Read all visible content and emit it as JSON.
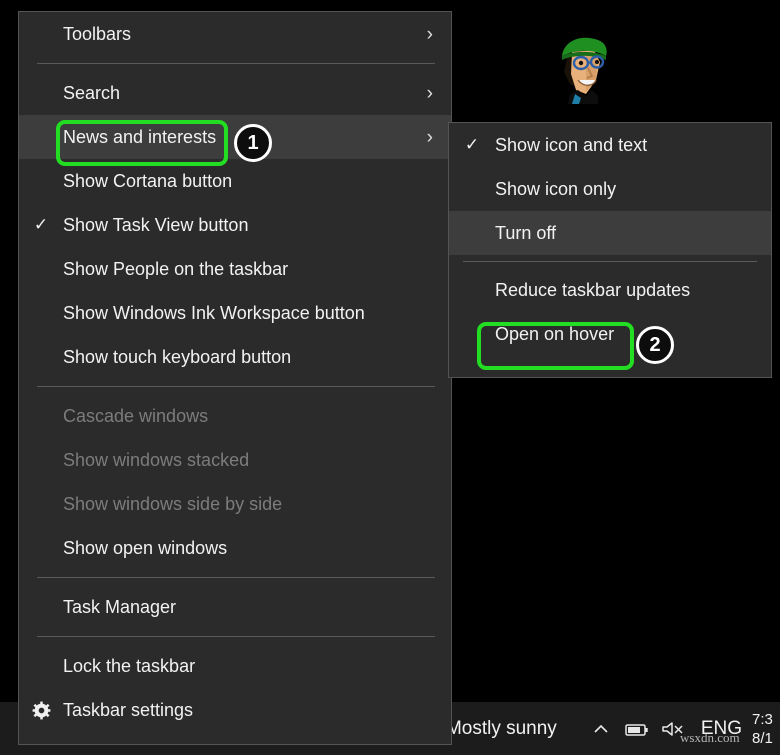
{
  "desktop": {
    "background_color": "#000000",
    "avatar_alt": "cartoon-character-green-cap"
  },
  "main_menu": {
    "name": "taskbar-context-menu",
    "items": [
      {
        "label": "Toolbars",
        "checked": false,
        "submenu": true,
        "disabled": false,
        "highlighted": false
      },
      {
        "separator": true
      },
      {
        "label": "Search",
        "checked": false,
        "submenu": true,
        "disabled": false,
        "highlighted": false
      },
      {
        "label": "News and interests",
        "checked": false,
        "submenu": true,
        "disabled": false,
        "highlighted": true
      },
      {
        "label": "Show Cortana button",
        "checked": false,
        "submenu": false,
        "disabled": false,
        "highlighted": false
      },
      {
        "label": "Show Task View button",
        "checked": true,
        "submenu": false,
        "disabled": false,
        "highlighted": false
      },
      {
        "label": "Show People on the taskbar",
        "checked": false,
        "submenu": false,
        "disabled": false,
        "highlighted": false
      },
      {
        "label": "Show Windows Ink Workspace button",
        "checked": false,
        "submenu": false,
        "disabled": false,
        "highlighted": false
      },
      {
        "label": "Show touch keyboard button",
        "checked": false,
        "submenu": false,
        "disabled": false,
        "highlighted": false
      },
      {
        "separator": true
      },
      {
        "label": "Cascade windows",
        "checked": false,
        "submenu": false,
        "disabled": true,
        "highlighted": false
      },
      {
        "label": "Show windows stacked",
        "checked": false,
        "submenu": false,
        "disabled": true,
        "highlighted": false
      },
      {
        "label": "Show windows side by side",
        "checked": false,
        "submenu": false,
        "disabled": true,
        "highlighted": false
      },
      {
        "label": "Show open windows",
        "checked": false,
        "submenu": false,
        "disabled": false,
        "highlighted": false
      },
      {
        "separator": true
      },
      {
        "label": "Task Manager",
        "checked": false,
        "submenu": false,
        "disabled": false,
        "highlighted": false
      },
      {
        "separator": true
      },
      {
        "label": "Lock the taskbar",
        "checked": false,
        "submenu": false,
        "disabled": false,
        "highlighted": false
      },
      {
        "label": "Taskbar settings",
        "checked": false,
        "submenu": false,
        "disabled": false,
        "highlighted": false,
        "icon": "gear-icon"
      }
    ]
  },
  "sub_menu": {
    "name": "news-and-interests-submenu",
    "items": [
      {
        "label": "Show icon and text",
        "checked": true,
        "highlighted": false
      },
      {
        "label": "Show icon only",
        "checked": false,
        "highlighted": false
      },
      {
        "label": "Turn off",
        "checked": false,
        "highlighted": true
      },
      {
        "separator": true
      },
      {
        "label": "Reduce taskbar updates",
        "checked": false,
        "highlighted": false
      },
      {
        "label": "Open on hover",
        "checked": false,
        "highlighted": false
      }
    ]
  },
  "taskbar": {
    "weather_text": "Mostly sunny",
    "chevron_icon": "show-hidden-icons-chevron-up",
    "battery_icon": "battery-icon",
    "volume_icon": "volume-muted-icon",
    "language": "ENG",
    "clock_time": "7:3",
    "clock_date": "8/1"
  },
  "annotations": {
    "highlight_color": "#22dd22",
    "steps": [
      {
        "number": "1",
        "targets": "News and interests"
      },
      {
        "number": "2",
        "targets": "Open on hover"
      }
    ]
  },
  "watermark": {
    "text": "wsxdn.com"
  }
}
